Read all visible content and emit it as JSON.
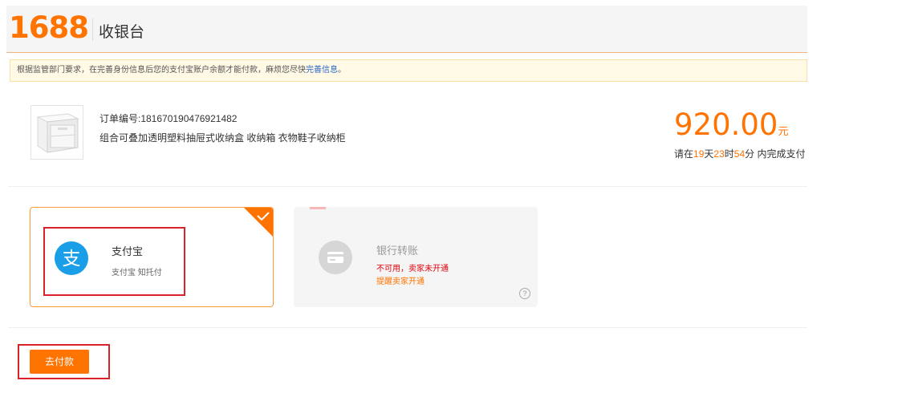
{
  "header": {
    "logo": "1688",
    "title": "收银台"
  },
  "notice": {
    "text": "根据监管部门要求，在完善身份信息后您的支付宝账户余额才能付款，麻烦您尽快",
    "link": "完善信息",
    "suffix": "。"
  },
  "order": {
    "number_label": "订单编号:181670190476921482",
    "title": "组合可叠加透明塑料抽屉式收纳盒 收纳箱 衣物鞋子收纳柜",
    "amount": "920.00",
    "currency": "元",
    "deadline": {
      "prefix": "请在",
      "days": "19",
      "days_unit": "天",
      "hours": "23",
      "hours_unit": "时",
      "minutes": "54",
      "suffix": "分 内完成支付"
    }
  },
  "payment_methods": {
    "alipay": {
      "title": "支付宝",
      "subtitle": "支付宝 知托付",
      "selected": true,
      "icon": "alipay-icon"
    },
    "bank": {
      "title": "银行转账",
      "line1": "不可用，卖家未开通",
      "line2": "提醒卖家开通",
      "help": "?",
      "icon": "bank-card-icon"
    }
  },
  "actions": {
    "pay_label": "去付款"
  },
  "colors": {
    "brand": "#ff7300",
    "alipay": "#1a9ee8",
    "highlight": "#d8232a"
  }
}
